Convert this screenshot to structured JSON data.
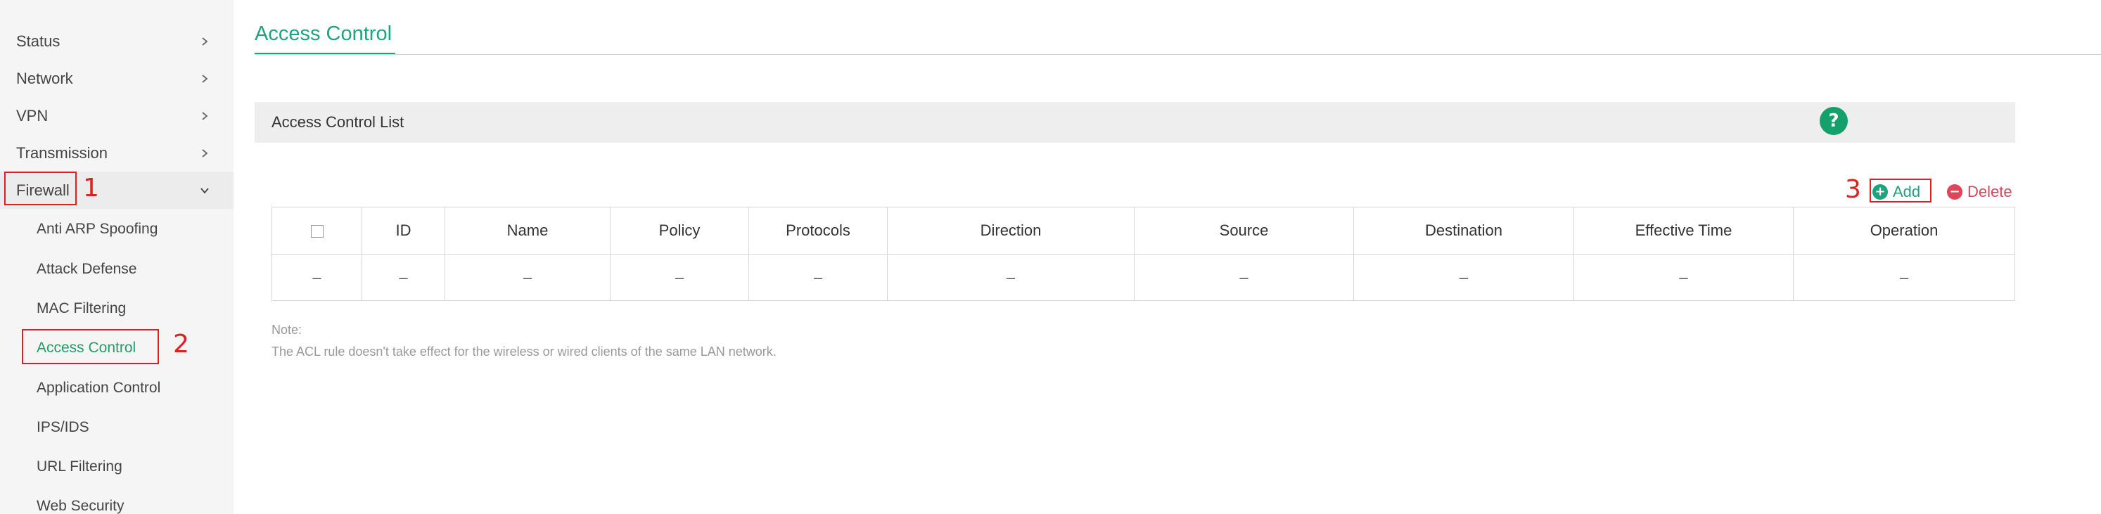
{
  "sidebar": {
    "items": [
      {
        "label": "Status"
      },
      {
        "label": "Network"
      },
      {
        "label": "VPN"
      },
      {
        "label": "Transmission"
      },
      {
        "label": "Firewall"
      }
    ],
    "firewall_sub": [
      {
        "label": "Anti ARP Spoofing"
      },
      {
        "label": "Attack Defense"
      },
      {
        "label": "MAC Filtering"
      },
      {
        "label": "Access Control"
      },
      {
        "label": "Application Control"
      },
      {
        "label": "IPS/IDS"
      },
      {
        "label": "URL Filtering"
      },
      {
        "label": "Web Security"
      }
    ],
    "active_item": "Access Control"
  },
  "annotations": {
    "step1": "1",
    "step2": "2",
    "step3": "3"
  },
  "header": {
    "title": "Access Control"
  },
  "section": {
    "title": "Access Control List",
    "help_label": "?"
  },
  "toolbar": {
    "add_label": "Add",
    "add_symbol": "+",
    "delete_label": "Delete",
    "delete_symbol": "−"
  },
  "table": {
    "columns": [
      "",
      "ID",
      "Name",
      "Policy",
      "Protocols",
      "Direction",
      "Source",
      "Destination",
      "Effective Time",
      "Operation"
    ],
    "rows": [
      [
        "–",
        "–",
        "–",
        "–",
        "–",
        "–",
        "–",
        "–",
        "–",
        "–"
      ]
    ]
  },
  "note": {
    "label": "Note:",
    "text": "The ACL rule doesn't take effect for the wireless or wired clients of the same LAN network."
  },
  "colors": {
    "accent": "#1fa37a",
    "danger": "#e0445a",
    "annotation": "#e02020"
  }
}
